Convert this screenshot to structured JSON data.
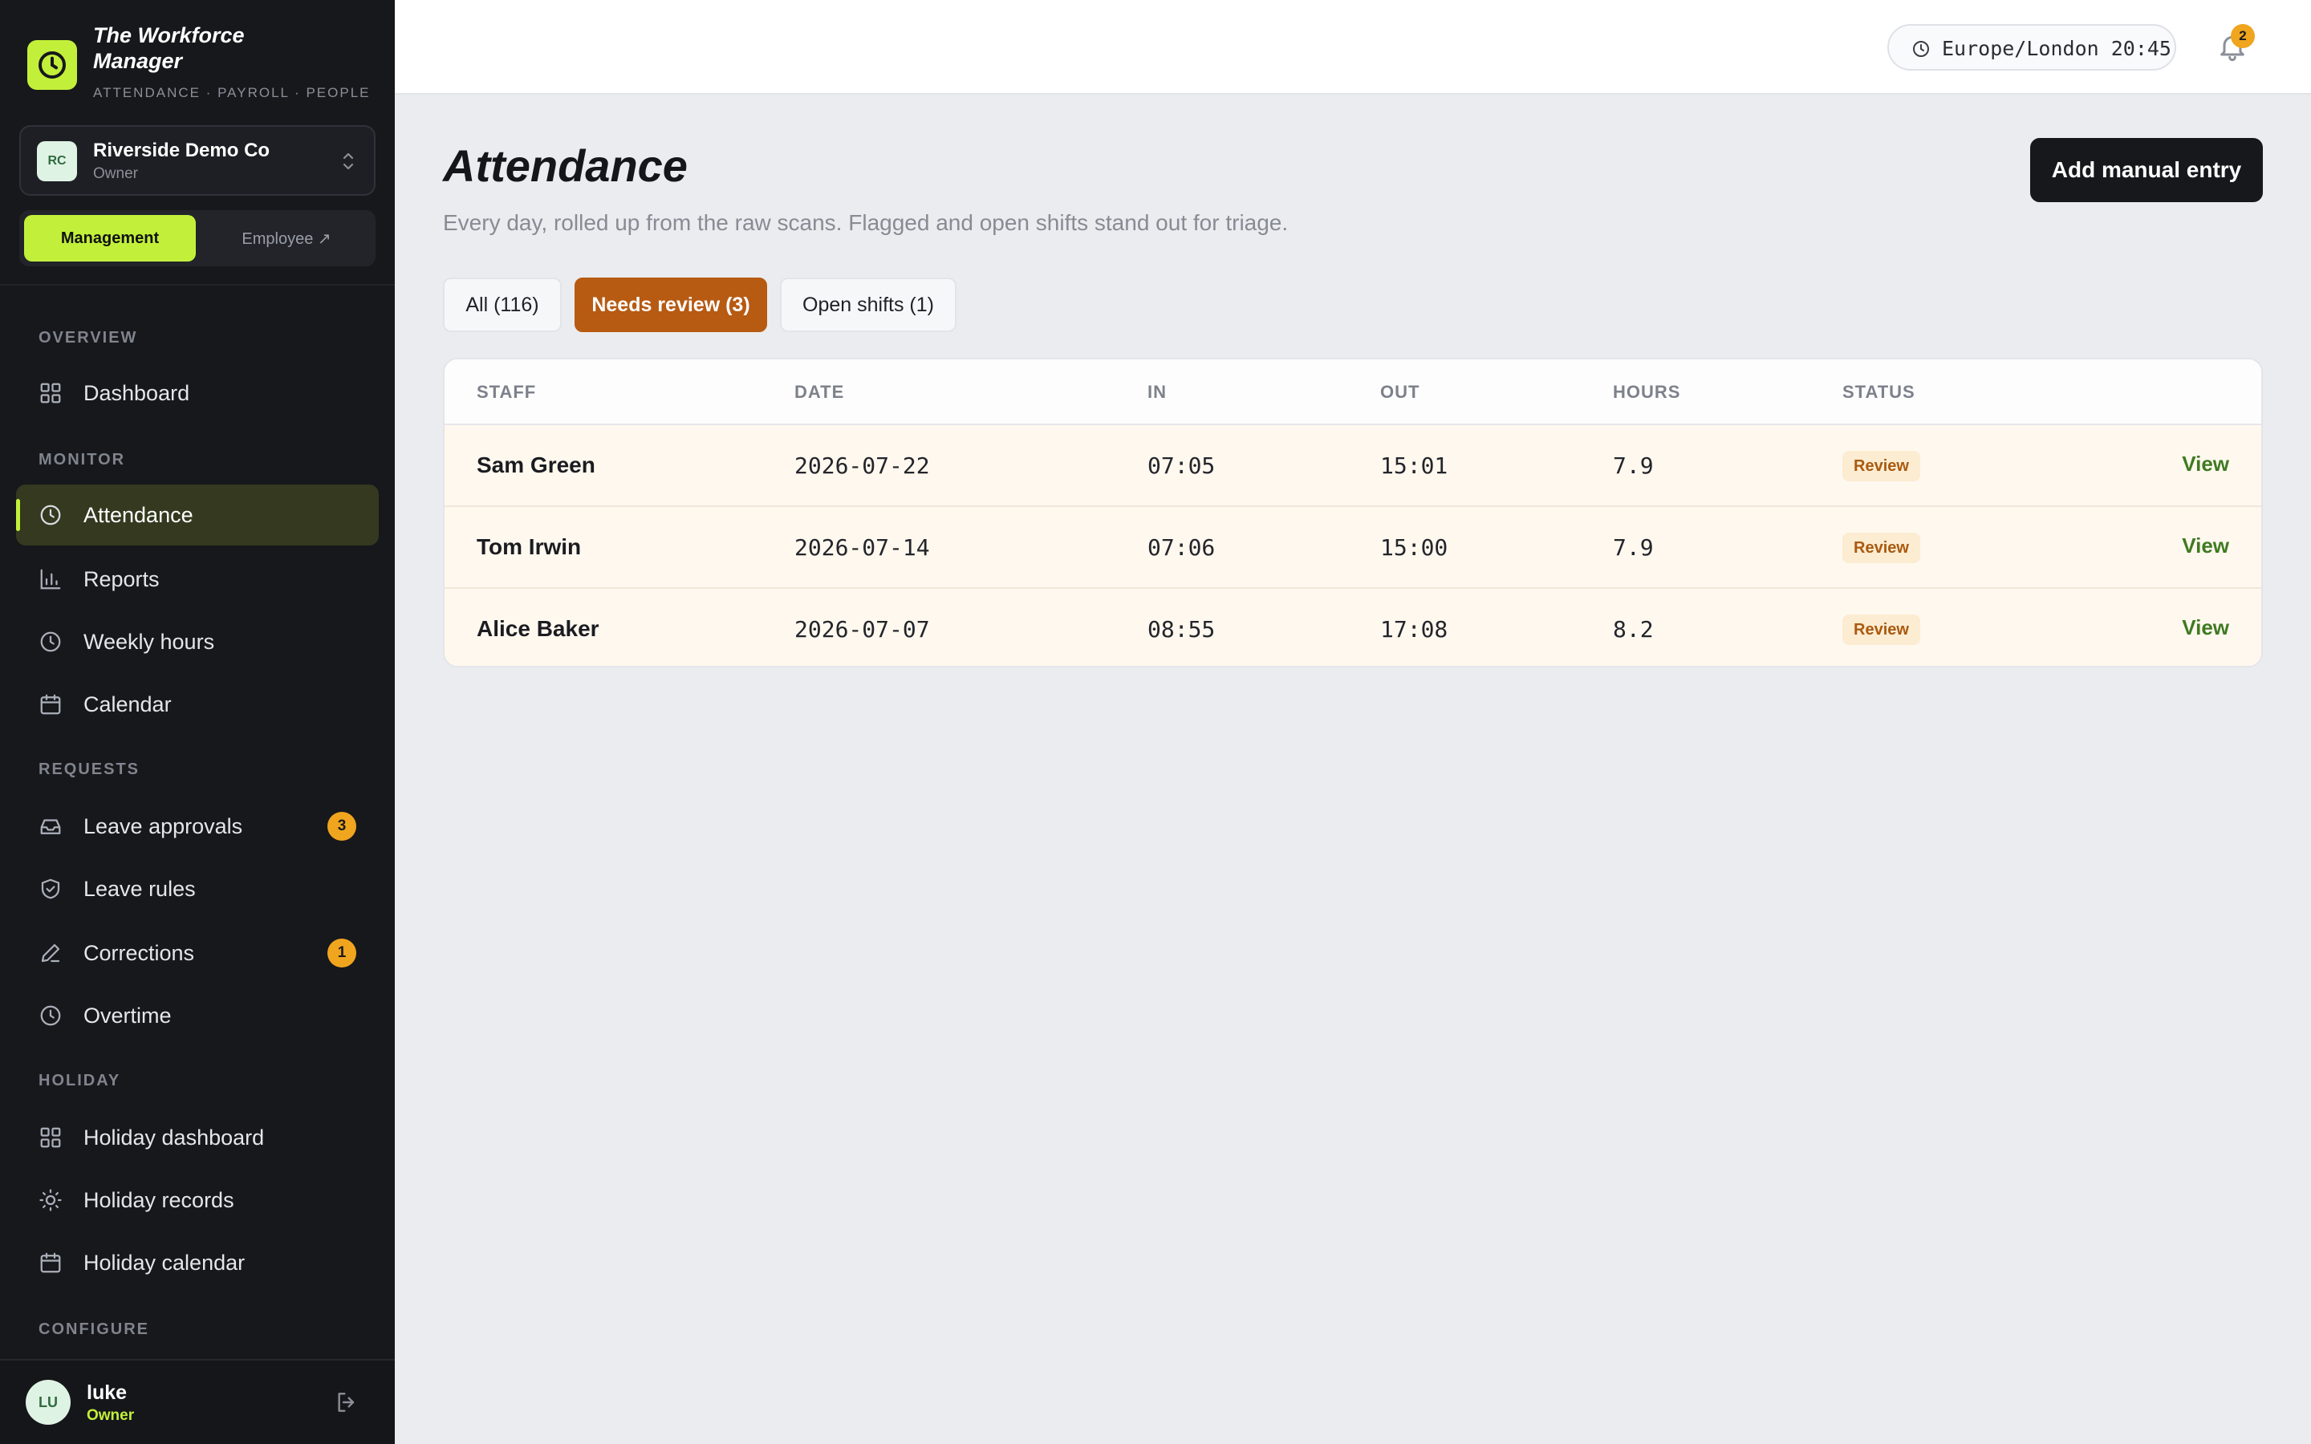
{
  "brand": {
    "title": "The Workforce Manager",
    "subtitle": "ATTENDANCE · PAYROLL · PEOPLE",
    "accent": "#c2f03a"
  },
  "org": {
    "initials": "RC",
    "name": "Riverside Demo Co",
    "role": "Owner"
  },
  "mode": {
    "management": "Management",
    "employee": "Employee ↗"
  },
  "sections": {
    "overview": "OVERVIEW",
    "monitor": "MONITOR",
    "requests": "REQUESTS",
    "holiday": "HOLIDAY",
    "configure": "CONFIGURE"
  },
  "nav": {
    "dashboard": "Dashboard",
    "attendance": "Attendance",
    "reports": "Reports",
    "weekly_hours": "Weekly hours",
    "calendar": "Calendar",
    "leave_approvals": "Leave approvals",
    "leave_approvals_badge": "3",
    "leave_rules": "Leave rules",
    "corrections": "Corrections",
    "corrections_badge": "1",
    "overtime": "Overtime",
    "holiday_dashboard": "Holiday dashboard",
    "holiday_records": "Holiday records",
    "holiday_calendar": "Holiday calendar"
  },
  "user": {
    "initials": "LU",
    "name": "luke",
    "role": "Owner"
  },
  "topbar": {
    "timezone": "Europe/London 20:45",
    "notifications_count": "2"
  },
  "page": {
    "title": "Attendance",
    "subtitle": "Every day, rolled up from the raw scans. Flagged and open shifts stand out for triage.",
    "add_button": "Add manual entry"
  },
  "tabs": {
    "all": "All (116)",
    "needs_review": "Needs review (3)",
    "open_shifts": "Open shifts (1)"
  },
  "table": {
    "headers": {
      "staff": "STAFF",
      "date": "DATE",
      "in": "IN",
      "out": "OUT",
      "hours": "HOURS",
      "status": "STATUS"
    },
    "rows": [
      {
        "staff": "Sam Green",
        "date": "2026-07-22",
        "in": "07:05",
        "out": "15:01",
        "hours": "7.9",
        "status": "Review",
        "action": "View"
      },
      {
        "staff": "Tom Irwin",
        "date": "2026-07-14",
        "in": "07:06",
        "out": "15:00",
        "hours": "7.9",
        "status": "Review",
        "action": "View"
      },
      {
        "staff": "Alice Baker",
        "date": "2026-07-07",
        "in": "08:55",
        "out": "17:08",
        "hours": "8.2",
        "status": "Review",
        "action": "View"
      }
    ]
  },
  "icons": {
    "brand": "clock-icon",
    "dashboard": "grid-icon",
    "attendance": "clock-icon",
    "reports": "bar-chart-icon",
    "weekly_hours": "clock-icon",
    "calendar": "calendar-icon",
    "leave_approvals": "inbox-icon",
    "leave_rules": "shield-check-icon",
    "corrections": "pencil-icon",
    "overtime": "clock-icon",
    "holiday_dashboard": "grid-icon",
    "holiday_records": "sun-icon",
    "holiday_calendar": "calendar-icon",
    "logout": "logout-icon",
    "bell": "bell-icon"
  }
}
